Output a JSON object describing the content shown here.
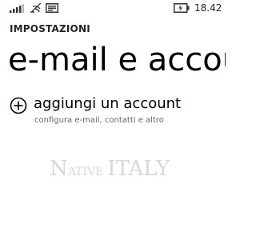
{
  "status_bar": {
    "time": "18.42",
    "icons": [
      "signal-icon",
      "wifi-icon",
      "message-icon",
      "battery-charging-icon"
    ]
  },
  "header": {
    "section": "IMPOSTAZIONI",
    "title": "e-mail e account"
  },
  "add_account": {
    "icon": "plus-circle-icon",
    "label": "aggiungi un account",
    "description": "configura e-mail, contatti e altro"
  },
  "watermark": {
    "text": "NATIVE ITALY"
  }
}
